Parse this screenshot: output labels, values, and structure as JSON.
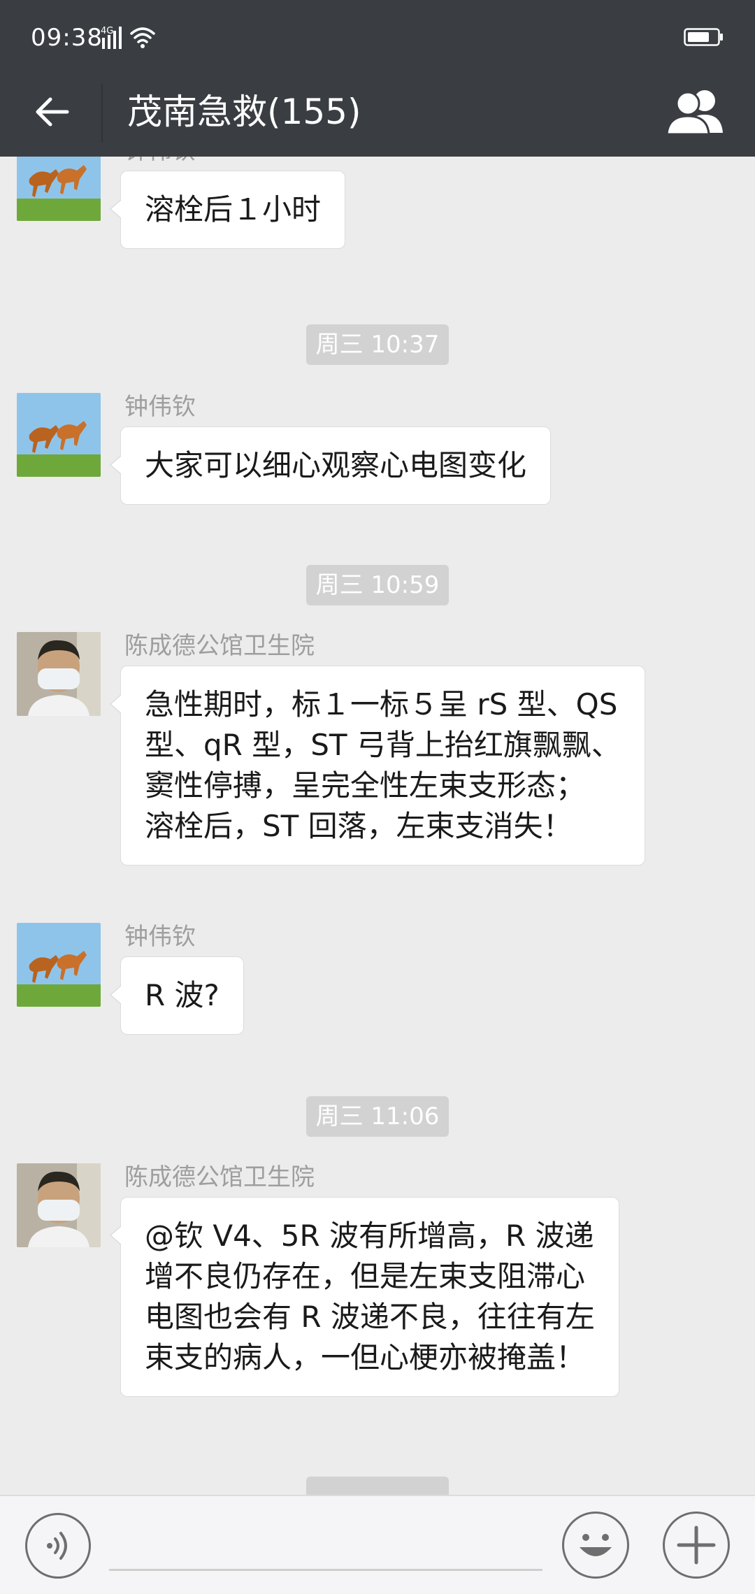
{
  "status_bar": {
    "time": "09:38",
    "network": "4G",
    "icons": [
      "signal-icon",
      "wifi-icon",
      "battery-icon"
    ]
  },
  "header": {
    "title": "茂南急救(155)",
    "icons": [
      "back-arrow-icon",
      "group-members-icon"
    ]
  },
  "messages": [
    {
      "sender": "钟伟钦",
      "avatar": "horses",
      "lines": [
        "溶栓后１小时"
      ]
    },
    {
      "timestamp": "周三 10:37"
    },
    {
      "sender": "钟伟钦",
      "avatar": "horses",
      "lines": [
        "大家可以细心观察心电图变化"
      ]
    },
    {
      "timestamp": "周三 10:59"
    },
    {
      "sender": "陈成德公馆卫生院",
      "avatar": "masked-person",
      "lines": [
        "急性期时，标１一标５呈 rS 型、QS",
        "型、qR 型，ST 弓背上抬红旗飘飘、",
        "窦性停搏，呈完全性左束支形态；",
        "溶栓后，ST 回落，左束支消失！"
      ]
    },
    {
      "sender": "钟伟钦",
      "avatar": "horses",
      "lines": [
        "R 波?"
      ]
    },
    {
      "timestamp": "周三 11:06"
    },
    {
      "sender": "陈成德公馆卫生院",
      "avatar": "masked-person",
      "lines": [
        "@钦  V4、5R 波有所增高，R 波递",
        "增不良仍存在，但是左束支阻滞心",
        "电图也会有 R 波递不良，往往有左",
        "束支的病人，一但心梗亦被掩盖！"
      ]
    }
  ],
  "input_bar": {
    "icons": [
      "voice-icon",
      "emoji-icon",
      "plus-icon"
    ]
  },
  "colors": {
    "header_bg": "#3a3e43",
    "chat_bg": "#ececec",
    "bubble_bg": "#ffffff",
    "timestamp_bg": "#d2d2d2",
    "sender_text": "#9e9e9e"
  }
}
